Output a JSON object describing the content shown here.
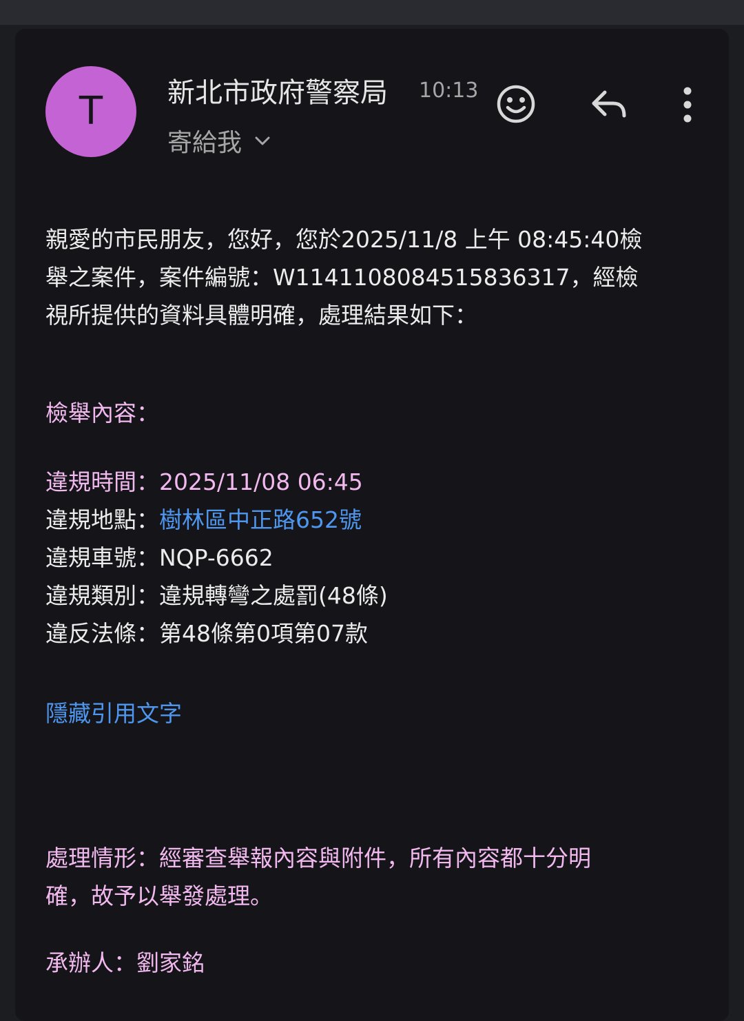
{
  "header": {
    "avatar_letter": "T",
    "sender": "新北市政府警察局",
    "time": "10:13",
    "recipient_label": "寄給我",
    "icons": [
      "emoji-icon",
      "reply-icon",
      "more-vert-icon"
    ]
  },
  "body": {
    "intro_lines": [
      "親愛的市民朋友，您好，您於2025/11/8 上午 08:45:40檢",
      "舉之案件，案件編號：W114110808451583631​7，經檢",
      "視所提供的資料具體明確，處理結果如下："
    ],
    "report_heading": "檢舉內容：",
    "details": {
      "time_label": "違規時間：",
      "time_value": "2025/11/08 06:45",
      "location_label": "違規地點：",
      "location_value": "樹林區中正路652號",
      "plate_label": "違規車號：",
      "plate_value": "NQP-6662",
      "category_label": "違規類別：",
      "category_value": "違規轉彎之處罰(48條)",
      "law_label": "違反法條：",
      "law_value": "第48條第0項第07款"
    },
    "hide_quoted": "隱藏引用文字",
    "result_lines": [
      "處理情形：經審查舉報內容與附件，所有內容都十分明",
      "確，故予以舉發處理。"
    ],
    "handler": "承辦人：劉家銘"
  },
  "colors": {
    "background": "#141419",
    "avatar": "#c464d4",
    "pink_text": "#f2b9ef",
    "link": "#4f97ee"
  }
}
